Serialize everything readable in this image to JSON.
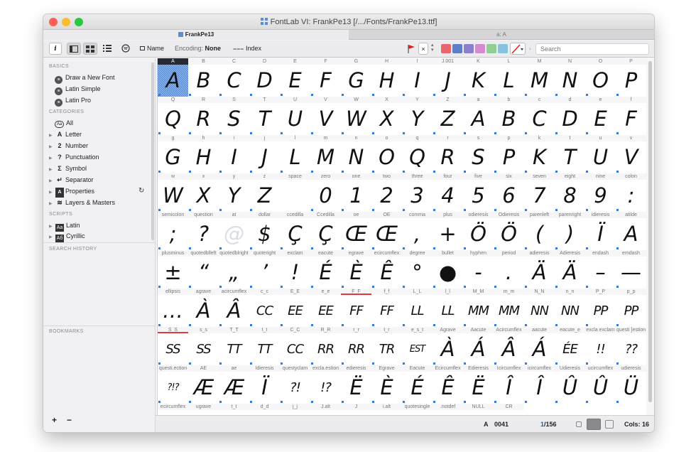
{
  "window": {
    "title": "FontLab VI: FrankPe13  [/.../Fonts/FrankPe13.ttf]",
    "traffic_colors": [
      "#fd5f57",
      "#fcbc2e",
      "#28c840"
    ]
  },
  "tabs": [
    {
      "label": "FrankPe13",
      "active": true
    },
    {
      "label": "a: A",
      "active": false
    }
  ],
  "toolbar": {
    "info_label": "i",
    "name_label": "Name",
    "encoding_prefix": "Encoding:",
    "encoding_value": "None",
    "index_label": "Index",
    "flag_icon": "flag-icon",
    "clear_label": "×",
    "color_swatches": [
      "#e8676c",
      "#5d7ec9",
      "#8b7fcf",
      "#d58bd1",
      "#8fcf91",
      "#86c3e0"
    ],
    "search_placeholder": "Search"
  },
  "sidebar": {
    "basics_title": "BASICS",
    "basics": [
      "Draw a New Font",
      "Latin Simple",
      "Latin Pro"
    ],
    "categories_title": "CATEGORIES",
    "all_label": "All",
    "categories": [
      {
        "symbol": "A",
        "label": "Letter"
      },
      {
        "symbol": "2",
        "label": "Number"
      },
      {
        "symbol": "?",
        "label": "Punctuation"
      },
      {
        "symbol": "Σ",
        "label": "Symbol"
      },
      {
        "symbol": "↵",
        "label": "Separator"
      },
      {
        "symbol": "A",
        "label": "Properties"
      },
      {
        "symbol": "≋",
        "label": "Layers & Masters"
      }
    ],
    "scripts_title": "SCRIPTS",
    "scripts": [
      {
        "symbol": "Aa",
        "label": "Latin"
      },
      {
        "symbol": "Аб",
        "label": "Cyrillic"
      }
    ],
    "search_history_title": "SEARCH HISTORY",
    "bookmarks_title": "BOOKMARKS",
    "add_label": "+",
    "remove_label": "−"
  },
  "glyph_grid": {
    "columns": 16,
    "selected_index": 0,
    "cells": [
      {
        "name": "A",
        "glyph": "A"
      },
      {
        "name": "B",
        "glyph": "B"
      },
      {
        "name": "C",
        "glyph": "C"
      },
      {
        "name": "D",
        "glyph": "D"
      },
      {
        "name": "E",
        "glyph": "E"
      },
      {
        "name": "F",
        "glyph": "F"
      },
      {
        "name": "G",
        "glyph": "G"
      },
      {
        "name": "H",
        "glyph": "H"
      },
      {
        "name": "I",
        "glyph": "I"
      },
      {
        "name": "J.001",
        "glyph": "J"
      },
      {
        "name": "K",
        "glyph": "K"
      },
      {
        "name": "L",
        "glyph": "L"
      },
      {
        "name": "M",
        "glyph": "M"
      },
      {
        "name": "N",
        "glyph": "N"
      },
      {
        "name": "O",
        "glyph": "O"
      },
      {
        "name": "P",
        "glyph": "P"
      },
      {
        "name": "Q",
        "glyph": "Q"
      },
      {
        "name": "R",
        "glyph": "R"
      },
      {
        "name": "S",
        "glyph": "S"
      },
      {
        "name": "T",
        "glyph": "T"
      },
      {
        "name": "U",
        "glyph": "U"
      },
      {
        "name": "V",
        "glyph": "V"
      },
      {
        "name": "W",
        "glyph": "W"
      },
      {
        "name": "X",
        "glyph": "X"
      },
      {
        "name": "Y",
        "glyph": "Y"
      },
      {
        "name": "Z",
        "glyph": "Z"
      },
      {
        "name": "a",
        "glyph": "A"
      },
      {
        "name": "b",
        "glyph": "B"
      },
      {
        "name": "c",
        "glyph": "C"
      },
      {
        "name": "d",
        "glyph": "D"
      },
      {
        "name": "e",
        "glyph": "E"
      },
      {
        "name": "f",
        "glyph": "F"
      },
      {
        "name": "g",
        "glyph": "G"
      },
      {
        "name": "h",
        "glyph": "H"
      },
      {
        "name": "i",
        "glyph": "I"
      },
      {
        "name": "j",
        "glyph": "J"
      },
      {
        "name": "l",
        "glyph": "L"
      },
      {
        "name": "m",
        "glyph": "M"
      },
      {
        "name": "n",
        "glyph": "N"
      },
      {
        "name": "o",
        "glyph": "O"
      },
      {
        "name": "q",
        "glyph": "Q"
      },
      {
        "name": "r",
        "glyph": "R"
      },
      {
        "name": "s",
        "glyph": "S"
      },
      {
        "name": "p",
        "glyph": "P"
      },
      {
        "name": "k",
        "glyph": "K"
      },
      {
        "name": "t",
        "glyph": "T"
      },
      {
        "name": "u",
        "glyph": "U"
      },
      {
        "name": "v",
        "glyph": "V"
      },
      {
        "name": "w",
        "glyph": "W"
      },
      {
        "name": "x",
        "glyph": "X"
      },
      {
        "name": "y",
        "glyph": "Y"
      },
      {
        "name": "z",
        "glyph": "Z"
      },
      {
        "name": "space",
        "glyph": ""
      },
      {
        "name": "zero",
        "glyph": "0"
      },
      {
        "name": "one",
        "glyph": "1"
      },
      {
        "name": "two",
        "glyph": "2"
      },
      {
        "name": "three",
        "glyph": "3"
      },
      {
        "name": "four",
        "glyph": "4"
      },
      {
        "name": "five",
        "glyph": "5"
      },
      {
        "name": "six",
        "glyph": "6"
      },
      {
        "name": "seven",
        "glyph": "7"
      },
      {
        "name": "eight",
        "glyph": "8"
      },
      {
        "name": "nine",
        "glyph": "9"
      },
      {
        "name": "colon",
        "glyph": ":"
      },
      {
        "name": "semicolon",
        "glyph": ";"
      },
      {
        "name": "question",
        "glyph": "?"
      },
      {
        "name": "at",
        "glyph": "@"
      },
      {
        "name": "dollar",
        "glyph": "$"
      },
      {
        "name": "ccedilla",
        "glyph": "Ç"
      },
      {
        "name": "Ccedilla",
        "glyph": "Ç"
      },
      {
        "name": "oe",
        "glyph": "Œ"
      },
      {
        "name": "OE",
        "glyph": "Œ"
      },
      {
        "name": "comma",
        "glyph": ","
      },
      {
        "name": "plus",
        "glyph": "+"
      },
      {
        "name": "odieresis",
        "glyph": "Ö"
      },
      {
        "name": "Odieresis",
        "glyph": "Ö"
      },
      {
        "name": "parenleft",
        "glyph": "("
      },
      {
        "name": "parenright",
        "glyph": ")"
      },
      {
        "name": "idieresis",
        "glyph": "Ï"
      },
      {
        "name": "atilde",
        "glyph": "A"
      },
      {
        "name": "plusminus",
        "glyph": "±"
      },
      {
        "name": "quotedblleft",
        "glyph": "“"
      },
      {
        "name": "quotedblright",
        "glyph": "„"
      },
      {
        "name": "quoteright",
        "glyph": "’"
      },
      {
        "name": "exclam",
        "glyph": "!"
      },
      {
        "name": "eacute",
        "glyph": "É"
      },
      {
        "name": "egrave",
        "glyph": "È"
      },
      {
        "name": "ecircumflex",
        "glyph": "Ê"
      },
      {
        "name": "degree",
        "glyph": "°"
      },
      {
        "name": "bullet",
        "glyph": "●"
      },
      {
        "name": "hyphen",
        "glyph": "-"
      },
      {
        "name": "period",
        "glyph": "."
      },
      {
        "name": "adieresis",
        "glyph": "Ä"
      },
      {
        "name": "Adieresis",
        "glyph": "Ä"
      },
      {
        "name": "endash",
        "glyph": "–"
      },
      {
        "name": "emdash",
        "glyph": "—"
      },
      {
        "name": "ellipsis",
        "glyph": "…"
      },
      {
        "name": "agrave",
        "glyph": "À"
      },
      {
        "name": "acircumflex",
        "glyph": "Â"
      },
      {
        "name": "c_c",
        "glyph": "CC"
      },
      {
        "name": "E_E",
        "glyph": "EE"
      },
      {
        "name": "e_e",
        "glyph": "EE"
      },
      {
        "name": "F_F",
        "glyph": "FF"
      },
      {
        "name": "f_f",
        "glyph": "FF"
      },
      {
        "name": "L_L",
        "glyph": "LL"
      },
      {
        "name": "l_l",
        "glyph": "LL"
      },
      {
        "name": "M_M",
        "glyph": "MM"
      },
      {
        "name": "m_m",
        "glyph": "MM"
      },
      {
        "name": "N_N",
        "glyph": "NN"
      },
      {
        "name": "n_n",
        "glyph": "NN"
      },
      {
        "name": "P_P",
        "glyph": "PP"
      },
      {
        "name": "p_p",
        "glyph": "PP"
      },
      {
        "name": "S_S",
        "glyph": "SS"
      },
      {
        "name": "s_s",
        "glyph": "SS"
      },
      {
        "name": "T_T",
        "glyph": "TT"
      },
      {
        "name": "t_t",
        "glyph": "TT"
      },
      {
        "name": "C_C",
        "glyph": "CC"
      },
      {
        "name": "R_R",
        "glyph": "RR"
      },
      {
        "name": "r_r",
        "glyph": "RR"
      },
      {
        "name": "t_r",
        "glyph": "TR"
      },
      {
        "name": "e_s_t",
        "glyph": "EST"
      },
      {
        "name": "Agrave",
        "glyph": "À"
      },
      {
        "name": "Aacute",
        "glyph": "Á"
      },
      {
        "name": "Acircumflex",
        "glyph": "Â"
      },
      {
        "name": "aacute",
        "glyph": "Á"
      },
      {
        "name": "eacute_e",
        "glyph": "ÉE"
      },
      {
        "name": "excla exclam",
        "glyph": "!!"
      },
      {
        "name": "questi ]estion",
        "glyph": "??"
      },
      {
        "name": "questi.ection",
        "glyph": "?!?"
      },
      {
        "name": "AE",
        "glyph": "Æ"
      },
      {
        "name": "ae",
        "glyph": "Æ"
      },
      {
        "name": "Idieresis",
        "glyph": "Ï"
      },
      {
        "name": "questyclam",
        "glyph": "?!"
      },
      {
        "name": "excla.estion",
        "glyph": "!?"
      },
      {
        "name": "edieresis",
        "glyph": "Ë"
      },
      {
        "name": "Egrave",
        "glyph": "È"
      },
      {
        "name": "Eacute",
        "glyph": "É"
      },
      {
        "name": "Ecircumflex",
        "glyph": "Ê"
      },
      {
        "name": "Edieresis",
        "glyph": "Ë"
      },
      {
        "name": "Icircumflex",
        "glyph": "Î"
      },
      {
        "name": "icircumflex",
        "glyph": "Î"
      },
      {
        "name": "Udieresis",
        "glyph": "Û"
      },
      {
        "name": "ucircumflex",
        "glyph": "Û"
      },
      {
        "name": "udieresis",
        "glyph": "Ü"
      },
      {
        "name": "ecircumflex",
        "glyph": ""
      },
      {
        "name": "ugrave",
        "glyph": ""
      },
      {
        "name": "t_t",
        "glyph": ""
      },
      {
        "name": "d_d",
        "glyph": ""
      },
      {
        "name": "j_j",
        "glyph": ""
      },
      {
        "name": "J.alt",
        "glyph": ""
      },
      {
        "name": "J",
        "glyph": ""
      },
      {
        "name": "i.alt",
        "glyph": ""
      },
      {
        "name": "quotesingle",
        "glyph": ""
      },
      {
        "name": ".notdef",
        "glyph": ""
      },
      {
        "name": "NULL",
        "glyph": ""
      },
      {
        "name": "CR",
        "glyph": ""
      }
    ]
  },
  "status": {
    "glyph_char": "A",
    "glyph_code": "0041",
    "position": "1",
    "total": "/156",
    "cols_label": "Cols: 16"
  }
}
